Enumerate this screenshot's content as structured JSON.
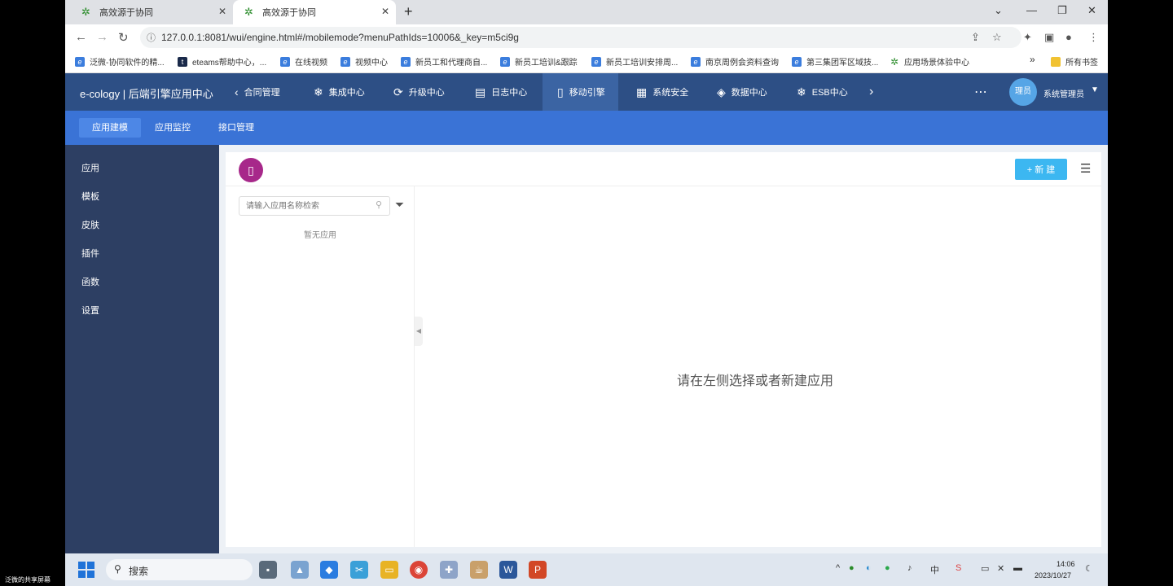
{
  "browser": {
    "tabs": [
      {
        "title": "高效源于协同",
        "active": false
      },
      {
        "title": "高效源于协同",
        "active": true
      }
    ],
    "url": "127.0.0.1:8081/wui/engine.html#/mobilemode?menuPathIds=10006&_key=m5ci9g",
    "bookmarks": [
      "泛微-协同软件的精...",
      "eteams帮助中心，...",
      "在线视频",
      "视频中心",
      "新员工和代理商自...",
      "新员工培训&跟踪",
      "新员工培训安排周...",
      "南京周例会资料查询",
      "第三集团军区域技...",
      "应用场景体验中心"
    ],
    "bookmarks_more": "»",
    "all_bookmarks": "所有书签"
  },
  "app": {
    "brand": "e-cology | 后端引擎应用中心",
    "top_nav": [
      "合同管理",
      "集成中心",
      "升级中心",
      "日志中心",
      "移动引擎",
      "系统安全",
      "数据中心",
      "ESB中心"
    ],
    "avatar_text": "理员",
    "user_name": "系统管理员",
    "sub_tabs": [
      "应用建模",
      "应用监控",
      "接口管理"
    ],
    "side_nav": [
      "应用",
      "模板",
      "皮肤",
      "插件",
      "函数",
      "设置"
    ],
    "new_button": "+ 新 建",
    "search_placeholder": "请输入应用名称检索",
    "empty_list": "暂无应用",
    "hint": "请在左侧选择或者新建应用"
  },
  "taskbar": {
    "search": "搜索",
    "time": "14:06",
    "date": "2023/10/27",
    "share_label": "泛微的共享屏幕"
  }
}
